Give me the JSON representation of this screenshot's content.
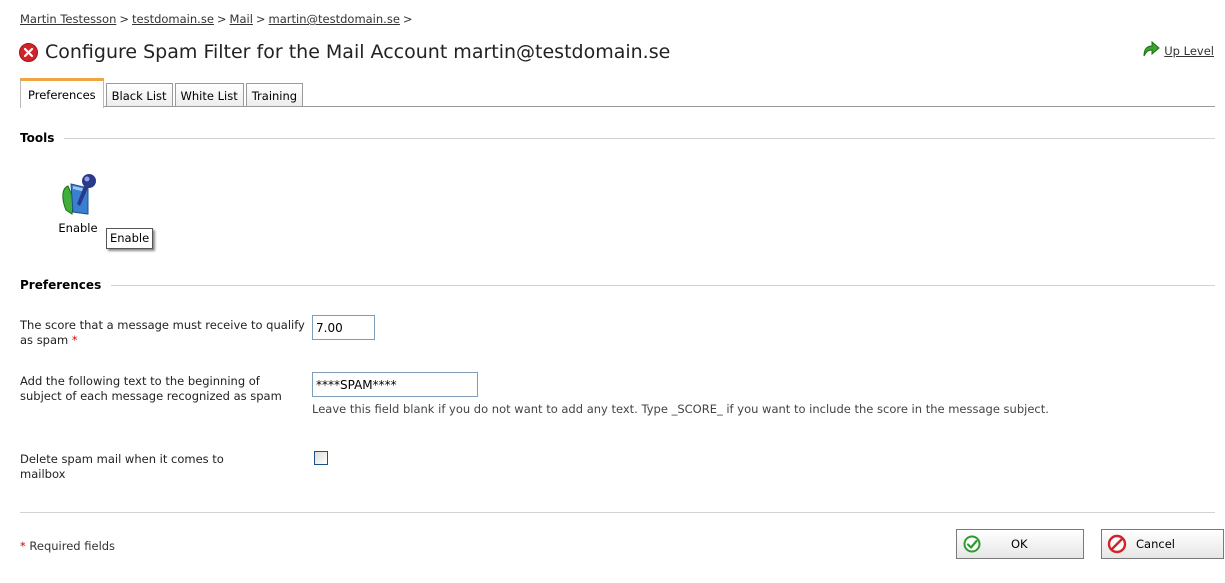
{
  "breadcrumb": {
    "items": [
      "Martin Testesson",
      "testdomain.se",
      "Mail",
      "martin@testdomain.se"
    ],
    "separator": ">"
  },
  "header": {
    "title": "Configure Spam Filter for the Mail Account martin@testdomain.se",
    "title_icon": "red-x-circle-icon",
    "up_level_label": "Up Level"
  },
  "tabs": [
    {
      "label": "Preferences",
      "active": true
    },
    {
      "label": "Black List",
      "active": false
    },
    {
      "label": "White List",
      "active": false
    },
    {
      "label": "Training",
      "active": false
    }
  ],
  "tools": {
    "section_title": "Tools",
    "enable_label": "Enable",
    "tooltip": "Enable"
  },
  "preferences": {
    "section_title": "Preferences",
    "score": {
      "label": "The score that a message must receive to qualify as spam",
      "required_mark": "*",
      "value": "7.00"
    },
    "subject": {
      "label": "Add the following text to the beginning of subject of each message recognized as spam",
      "value": "****SPAM****",
      "hint": "Leave this field blank if you do not want to add any text. Type _SCORE_ if you want to include the score in the message subject."
    },
    "delete": {
      "label": "Delete spam mail when it comes to mailbox",
      "checked": false
    }
  },
  "footer": {
    "required_mark": "*",
    "required_note": "Required fields",
    "ok_label": "OK",
    "cancel_label": "Cancel"
  },
  "colors": {
    "tab_accent": "#f0a640",
    "required": "#d40000",
    "ok_icon": "#2f9a2f",
    "cancel_icon": "#d2232a"
  }
}
